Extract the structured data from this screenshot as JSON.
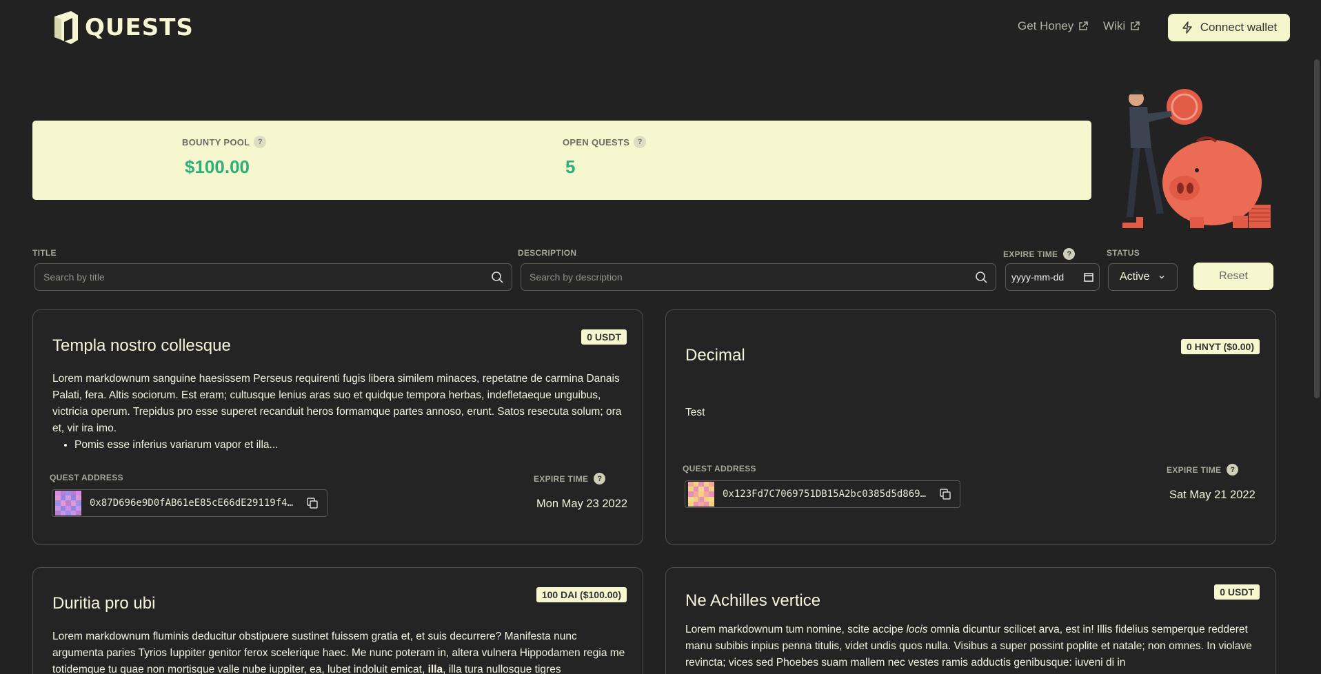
{
  "header": {
    "logo_text": "QUESTS",
    "links": [
      {
        "label": "Get Honey"
      },
      {
        "label": "Wiki"
      }
    ],
    "connect_label": "Connect wallet"
  },
  "stats": {
    "bounty_label": "BOUNTY POOL",
    "bounty_value": "$100.00",
    "open_label": "OPEN QUESTS",
    "open_value": "5"
  },
  "filters": {
    "title_label": "TITLE",
    "title_placeholder": "Search by title",
    "description_label": "DESCRIPTION",
    "description_placeholder": "Search by description",
    "expire_label": "EXPIRE TIME",
    "expire_placeholder": "yyyy-mm-dd",
    "status_label": "STATUS",
    "status_value": "Active",
    "reset_label": "Reset"
  },
  "colors": {
    "accent": "#f6f6cf",
    "value_green": "#2cb07a",
    "background": "#222222"
  },
  "quests": [
    {
      "title": "Templa nostro collesque",
      "bounty": "0 USDT",
      "description": "Lorem markdownum sanguine haesissem Perseus requirenti fugis libera similem minaces, repetatne de carmina Danais Palati, fera. Altis sociorum. Est eram; cultusque lenius aras suo et quidque tempora herbas, indefletaeque unguibus, victricia operum. Trepidus pro esse superet recanduit heros formamque partes annoso, erunt. Satos resecuta solum; ora et, vir ira imo.",
      "bullet": "Pomis esse inferius variarum vapor et illa...",
      "address_label": "QUEST ADDRESS",
      "address": "0x87D696e9D0fAB61eE85cE66dE29119f4…",
      "expire_label": "EXPIRE TIME",
      "expire_value": "Mon May 23 2022"
    },
    {
      "title": "Decimal",
      "bounty": "0 HNYT ($0.00)",
      "description": "Test",
      "address_label": "QUEST ADDRESS",
      "address": "0x123Fd7C7069751DB15A2bc0385d5d869…",
      "expire_label": "EXPIRE TIME",
      "expire_value": "Sat May 21 2022"
    },
    {
      "title": "Duritia pro ubi",
      "bounty": "100 DAI ($100.00)",
      "description_parts": [
        "Lorem markdownum fluminis deducitur obstipuere sustinet fuissem gratia et, et suis decurrere? Manifesta nunc argumenta paries Tyrios Iuppiter genitor ferox scelerique haec. Me nunc poteram in, altera vulnera Hippodamen regia me totidemque tu quae non mortisque valle nube iuppiter, ea, lubet indoluit emicat, ",
        "illa",
        ", illa tura nullosque tigres"
      ]
    },
    {
      "title": "Ne Achilles vertice",
      "bounty": "0 USDT",
      "description_parts": [
        "Lorem markdownum tum nomine, scite accipe ",
        "locis",
        " omnia dicuntur scilicet arva, est in! Illis fidelius semperque redderet manu subibis inpius penna titulis, videt undis quos nulla. Visibus a super possint poplite et natale; non omnes. In violave revincta; vices sed Phoebes suam mallem nec vestes ramis adductis genibusque: iuveni di in"
      ]
    }
  ]
}
